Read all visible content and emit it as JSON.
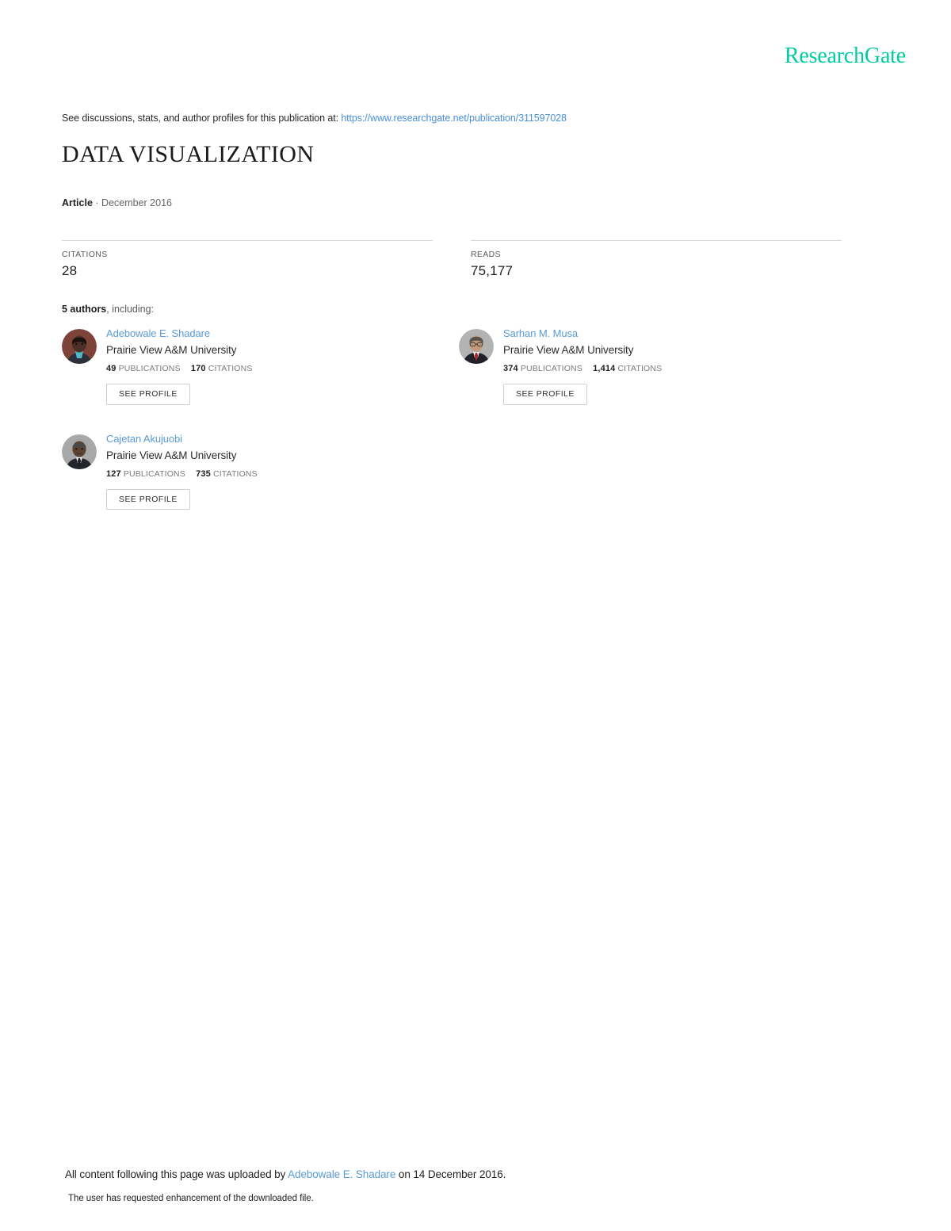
{
  "site": {
    "logo_text": "ResearchGate",
    "logo_color": "#00cca4"
  },
  "header": {
    "discussions_prefix": "See discussions, stats, and author profiles for this publication at:",
    "publication_url": "https://www.researchgate.net/publication/311597028"
  },
  "publication": {
    "title": "DATA VISUALIZATION",
    "type": "Article",
    "date_separator": "·",
    "date": "December 2016"
  },
  "stats": [
    {
      "label": "CITATIONS",
      "value": "28"
    },
    {
      "label": "READS",
      "value": "75,177"
    }
  ],
  "authors_section": {
    "count_text": "5 authors",
    "including_text": ", including:",
    "publications_label": "PUBLICATIONS",
    "citations_label": "CITATIONS",
    "see_profile_label": "SEE PROFILE"
  },
  "authors": [
    {
      "name": "Adebowale E. Shadare",
      "affiliation": "Prairie View A&M University",
      "publications": "49",
      "citations": "170",
      "avatar_bg": "#7d4339",
      "avatar_skin": "#4a3026",
      "avatar_suit": "#2a2f3a",
      "avatar_shirt": "#4fb8c9"
    },
    {
      "name": "Sarhan M. Musa",
      "affiliation": "Prairie View A&M University",
      "publications": "374",
      "citations": "1,414",
      "avatar_bg": "#b3b3b3",
      "avatar_skin": "#c59a78",
      "avatar_suit": "#1e2128",
      "avatar_shirt": "#b3252c"
    },
    {
      "name": "Cajetan Akujuobi",
      "affiliation": "Prairie View A&M University",
      "publications": "127",
      "citations": "735",
      "avatar_bg": "#a8a8a8",
      "avatar_skin": "#5b4334",
      "avatar_suit": "#23262d",
      "avatar_shirt": "#e8e8e8"
    }
  ],
  "footer": {
    "upload_prefix": "All content following this page was uploaded by",
    "uploader": "Adebowale E. Shadare",
    "upload_suffix": "on 14 December 2016.",
    "enhancement_note": "The user has requested enhancement of the downloaded file."
  }
}
